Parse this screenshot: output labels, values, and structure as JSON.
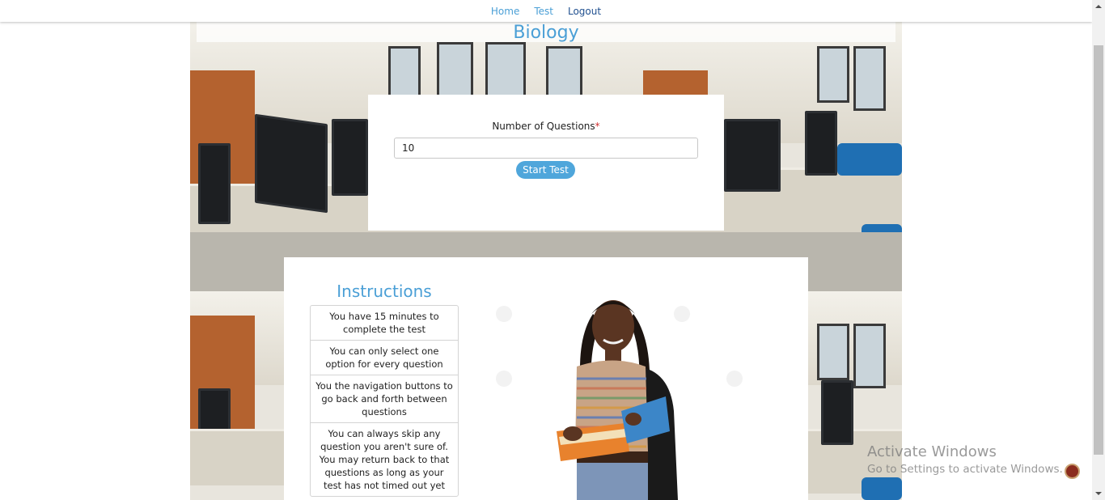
{
  "nav": {
    "home": "Home",
    "test": "Test",
    "logout": "Logout"
  },
  "subject": {
    "title": "Biology"
  },
  "question_form": {
    "label": "Number of Questions",
    "required_mark": "*",
    "value": "10",
    "start_button": "Start Test"
  },
  "instructions": {
    "title": "Instructions",
    "items": [
      "You have 15 minutes to complete the test",
      "You can only select one option for every question",
      "You the navigation buttons to go back and forth between questions",
      "You can always skip any question you aren't sure of. You may return back to that questions as long as your test has not timed out yet"
    ]
  },
  "os_watermark": {
    "line1": "Activate Windows",
    "line2": "Go to Settings to activate Windows."
  },
  "colors": {
    "accent": "#4a9fd6",
    "nav_dark": "#1f4f8f",
    "button": "#4fa6db",
    "required": "#d03030"
  }
}
